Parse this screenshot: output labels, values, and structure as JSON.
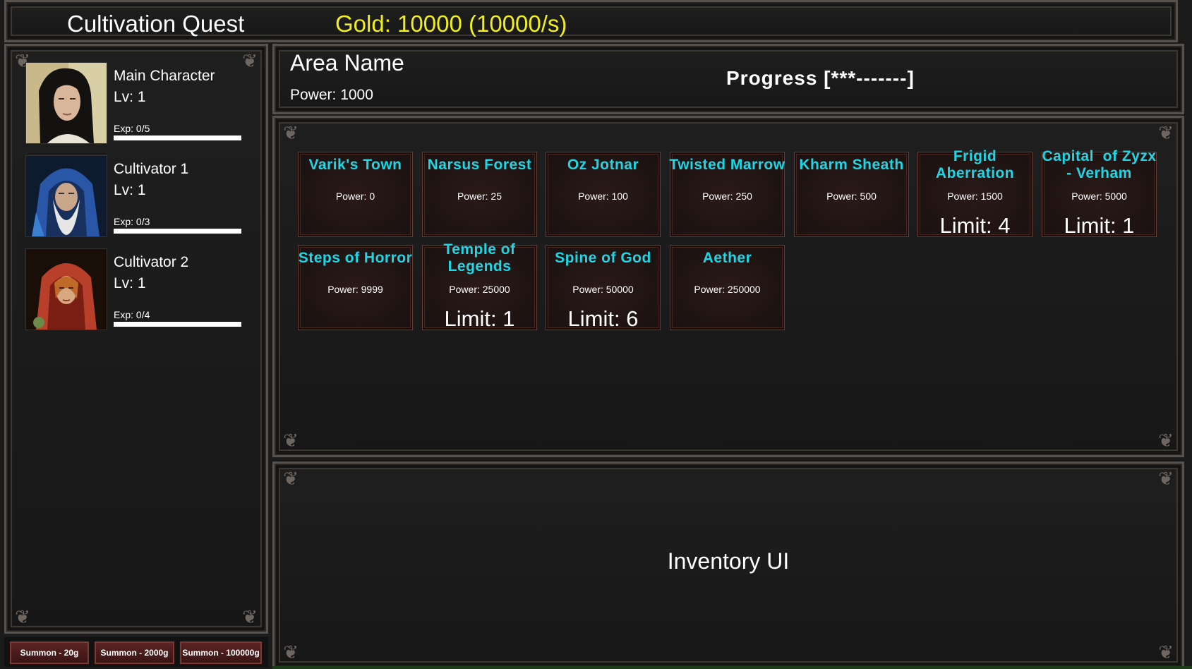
{
  "header": {
    "title": "Cultivation Quest",
    "gold_text": "Gold: 10000 (10000/s)"
  },
  "characters": [
    {
      "name": "Main Character",
      "level": "Lv: 1",
      "exp": "Exp: 0/5",
      "exp_fraction": 0.0,
      "portrait": "dark-haired-warrior-portrait"
    },
    {
      "name": "Cultivator 1",
      "level": "Lv: 1",
      "exp": "Exp: 0/3",
      "exp_fraction": 0.0,
      "portrait": "hooded-old-sage-portrait"
    },
    {
      "name": "Cultivator 2",
      "level": "Lv: 1",
      "exp": "Exp: 0/4",
      "exp_fraction": 0.0,
      "portrait": "red-hooded-woman-portrait"
    }
  ],
  "summon_buttons": [
    {
      "label": "Summon - 20g"
    },
    {
      "label": "Summon - 2000g"
    },
    {
      "label": "Summon - 100000g"
    }
  ],
  "area_header": {
    "name": "Area Name",
    "power": "Power: 1000",
    "progress": "Progress [***-------]"
  },
  "areas": [
    {
      "name": "Varik's Town",
      "power": "Power: 0",
      "limit": ""
    },
    {
      "name": "Narsus Forest",
      "power": "Power: 25",
      "limit": ""
    },
    {
      "name": "Oz Jotnar",
      "power": "Power: 100",
      "limit": ""
    },
    {
      "name": "Twisted Marrow",
      "power": "Power: 250",
      "limit": ""
    },
    {
      "name": "Kharm Sheath",
      "power": "Power: 500",
      "limit": ""
    },
    {
      "name": "Frigid Aberration",
      "power": "Power: 1500",
      "limit": "Limit: 4"
    },
    {
      "name": "Capital  of Zyzx - Verham",
      "power": "Power: 5000",
      "limit": "Limit: 1"
    },
    {
      "name": "Steps of Horror",
      "power": "Power: 9999",
      "limit": ""
    },
    {
      "name": "Temple of Legends",
      "power": "Power: 25000",
      "limit": "Limit: 1"
    },
    {
      "name": "Spine of God",
      "power": "Power: 50000",
      "limit": "Limit: 6"
    },
    {
      "name": "Aether",
      "power": "Power: 250000",
      "limit": ""
    }
  ],
  "inventory": {
    "label": "Inventory UI"
  },
  "colors": {
    "gold": "#f1ef19",
    "area_name": "#1ed7e6"
  }
}
